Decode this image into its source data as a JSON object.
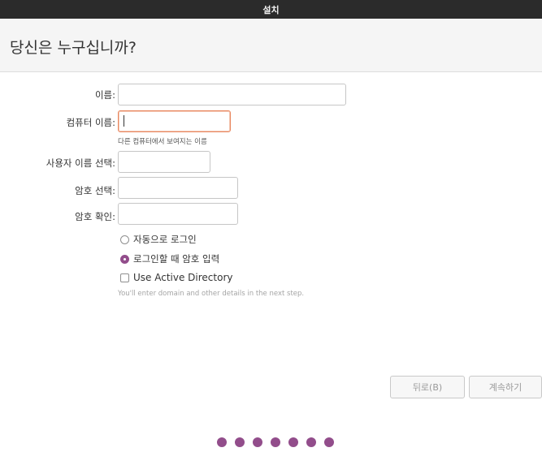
{
  "window": {
    "title": "설치"
  },
  "page": {
    "title": "당신은 누구십니까?"
  },
  "form": {
    "name_label": "이름:",
    "name_value": "",
    "computer_name_label": "컴퓨터 이름:",
    "computer_name_value": "",
    "computer_name_hint": "다른 컴퓨터에서 보여지는 이름",
    "username_label": "사용자 이름 선택:",
    "username_value": "",
    "password_label": "암호 선택:",
    "password_value": "",
    "password_confirm_label": "암호 확인:",
    "password_confirm_value": ""
  },
  "options": {
    "auto_login_label": "자동으로 로그인",
    "auto_login_selected": false,
    "require_password_label": "로그인할 때 암호 입력",
    "require_password_selected": true,
    "active_directory_label": "Use Active Directory",
    "active_directory_checked": false,
    "active_directory_hint": "You'll enter domain and other details in the next step."
  },
  "buttons": {
    "back_label": "뒤로(B)",
    "continue_label": "계속하기"
  },
  "progress": {
    "total_steps": 7
  },
  "colors": {
    "accent": "#924d8b",
    "focus_border": "#e9875f",
    "titlebar_bg": "#2b2b2b",
    "header_bg": "#f5f5f5"
  }
}
